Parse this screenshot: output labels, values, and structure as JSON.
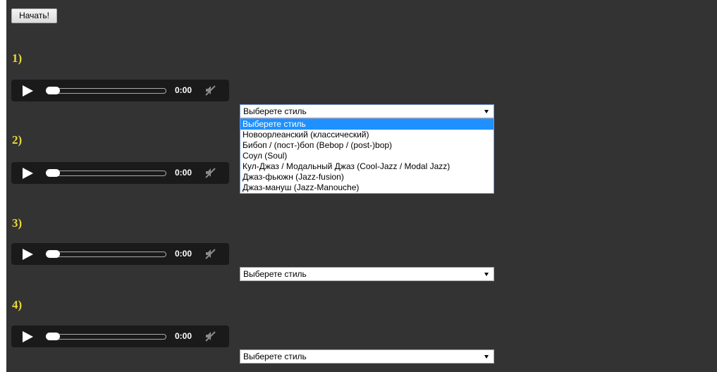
{
  "start_button": {
    "label": "Начать!"
  },
  "questions": [
    {
      "number": "1)",
      "time": "0:00",
      "select_value": "Выберете стиль"
    },
    {
      "number": "2)",
      "time": "0:00"
    },
    {
      "number": "3)",
      "time": "0:00",
      "select_value": "Выберете стиль"
    },
    {
      "number": "4)",
      "time": "0:00",
      "select_value": "Выберете стиль"
    }
  ],
  "dropdown": {
    "options": [
      "Выберете стиль",
      "Новоорлеанский (классический)",
      "Бибоп / (пост-)боп (Bebop / (post-)bop)",
      "Соул (Soul)",
      "Кул-Джаз / Модальный Джаз (Cool-Jazz / Modal Jazz)",
      "Джаз-фьюжн (Jazz-fusion)",
      "Джаз-мануш (Jazz-Manouche)"
    ],
    "highlighted_index": 0
  },
  "icons": {
    "play": "play-icon",
    "mute": "muted-speaker-icon",
    "arrow": "dropdown-arrow-icon"
  },
  "colors": {
    "page_background": "#333333",
    "question_number": "#e8d838",
    "player_background": "#1a1a1a",
    "option_highlight": "#1e90ff"
  }
}
